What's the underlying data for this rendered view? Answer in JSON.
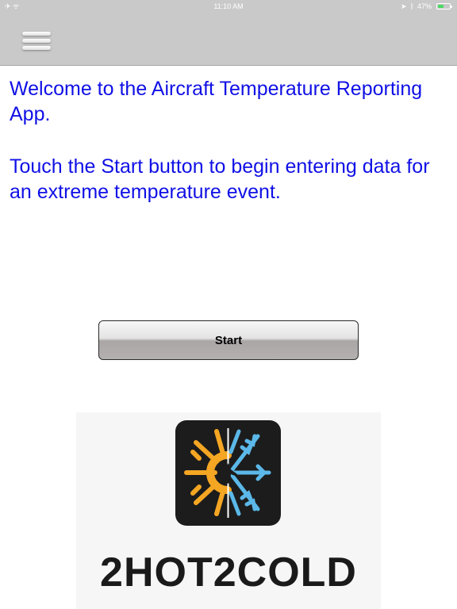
{
  "status_bar": {
    "left": "✈ ᯤ",
    "time": "11:10 AM",
    "location_glyph": "➤",
    "bluetooth_glyph": "ᛒ",
    "battery_percent": "47%",
    "battery_level": 0.47,
    "battery_color": "#4cd964"
  },
  "nav": {
    "menu_icon": "hamburger-menu-icon"
  },
  "content": {
    "welcome_text": "Welcome to the Aircraft Temperature Reporting App.",
    "instruction_text": "Touch the Start button to begin entering data for an extreme temperature event.",
    "text_color": "#1010e6"
  },
  "start_button": {
    "label": "Start"
  },
  "logo": {
    "text": "2HOT2COLD",
    "icon": "sun-snowflake-airplane-icon",
    "sun_color": "#f5a623",
    "snow_color": "#5bb8e8"
  }
}
